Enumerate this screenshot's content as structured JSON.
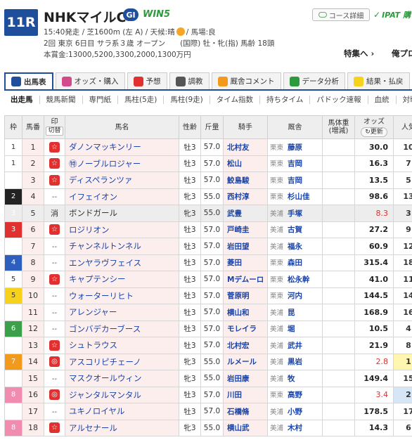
{
  "race": {
    "number": "11R",
    "name": "NHKマイルC",
    "grade": "GI",
    "win5": "WIN5",
    "line1_start": "15:40発走 / 芝1600m (左 A) / 天候:晴",
    "line1_end": "/ 馬場:良",
    "line2": "2回 東京 6日目 サラ系３歳 オープン　　(国際) 牡・牝(指) 馬齢 18頭",
    "line3": "本賞金:13000,5200,3300,2000,1300万円"
  },
  "buttons": {
    "course": "コース詳細",
    "ipat": "IPAT 購"
  },
  "features": {
    "special": "特集へ ›",
    "other": "俺プロ"
  },
  "tabs": [
    {
      "label": "出馬表",
      "color": "#1f4f9b"
    },
    {
      "label": "オッズ・購入",
      "color": "#d24a8a"
    },
    {
      "label": "予想",
      "color": "#e03030"
    },
    {
      "label": "調教",
      "color": "#555555"
    },
    {
      "label": "厩舎コメント",
      "color": "#f39a1c"
    },
    {
      "label": "データ分析",
      "color": "#2e9a3e"
    },
    {
      "label": "結果・払戻",
      "color": "#f6d21a"
    }
  ],
  "subtabs": [
    "出走馬",
    "競馬新聞",
    "専門紙",
    "馬柱(5走)",
    "馬柱(9走)",
    "タイム指数",
    "持ちタイム",
    "パドック速報",
    "血統",
    "対戦表"
  ],
  "columns": {
    "waku": "枠",
    "umaban": "馬番",
    "mark_top": "印",
    "mark_sub": "切替",
    "horse": "馬名",
    "sex_age": "性齢",
    "weight": "斤量",
    "jockey": "騎手",
    "trainer": "厩舎",
    "body_weight_top": "馬体重",
    "body_weight_sub": "(増減)",
    "odds": "オッズ",
    "odds_update": "更新",
    "popularity": "人気"
  },
  "rows": [
    {
      "waku": "1",
      "ban": "1",
      "mark": "☆",
      "horse": "ダノンマッキンリー",
      "sex": "牡3",
      "wt": "57.0",
      "jockey": "北村友",
      "region": "栗東",
      "trainer": "藤原",
      "odds": "30.0",
      "pop": "10"
    },
    {
      "waku": "1",
      "ban": "2",
      "mark": "☆",
      "horse": "㊕ノーブルロジャー",
      "sex": "牡3",
      "wt": "57.0",
      "jockey": "松山",
      "region": "栗東",
      "trainer": "吉岡",
      "odds": "16.3",
      "pop": "7"
    },
    {
      "waku": "2",
      "ban": "3",
      "mark": "☆",
      "horse": "ディスペランツァ",
      "sex": "牡3",
      "wt": "57.0",
      "jockey": "鮫島駿",
      "region": "栗東",
      "trainer": "吉岡",
      "odds": "13.5",
      "pop": "5"
    },
    {
      "waku": "2",
      "ban": "4",
      "mark": "--",
      "horse": "イフェイオン",
      "sex": "牝3",
      "wt": "55.0",
      "jockey": "西村淳",
      "region": "栗東",
      "trainer": "杉山佳",
      "odds": "98.6",
      "pop": "13"
    },
    {
      "waku": "3",
      "ban": "5",
      "mark": "消",
      "horse": "ボンドガール",
      "sex": "牝3",
      "wt": "55.0",
      "jockey": "武豊",
      "region": "美浦",
      "trainer": "手塚",
      "odds": "8.3",
      "pop": "3"
    },
    {
      "waku": "3",
      "ban": "6",
      "mark": "☆",
      "horse": "ロジリオン",
      "sex": "牡3",
      "wt": "57.0",
      "jockey": "戸崎圭",
      "region": "美浦",
      "trainer": "古賀",
      "odds": "27.2",
      "pop": "9"
    },
    {
      "waku": "4",
      "ban": "7",
      "mark": "--",
      "horse": "チャンネルトンネル",
      "sex": "牡3",
      "wt": "57.0",
      "jockey": "岩田望",
      "region": "美浦",
      "trainer": "福永",
      "odds": "60.9",
      "pop": "12"
    },
    {
      "waku": "4",
      "ban": "8",
      "mark": "--",
      "horse": "エンヤラヴフェイス",
      "sex": "牡3",
      "wt": "57.0",
      "jockey": "菱田",
      "region": "栗東",
      "trainer": "森田",
      "odds": "315.4",
      "pop": "18"
    },
    {
      "waku": "5",
      "ban": "9",
      "mark": "☆",
      "horse": "キャプテンシー",
      "sex": "牡3",
      "wt": "57.0",
      "jockey": "Mデムーロ",
      "region": "栗東",
      "trainer": "松永幹",
      "odds": "41.0",
      "pop": "11"
    },
    {
      "waku": "5",
      "ban": "10",
      "mark": "--",
      "horse": "ウォーターリヒト",
      "sex": "牡3",
      "wt": "57.0",
      "jockey": "菅原明",
      "region": "栗東",
      "trainer": "河内",
      "odds": "144.5",
      "pop": "14"
    },
    {
      "waku": "6",
      "ban": "11",
      "mark": "--",
      "horse": "アレンジャー",
      "sex": "牡3",
      "wt": "57.0",
      "jockey": "横山和",
      "region": "美浦",
      "trainer": "昆",
      "odds": "168.9",
      "pop": "16"
    },
    {
      "waku": "6",
      "ban": "12",
      "mark": "--",
      "horse": "ゴンバデカーブース",
      "sex": "牡3",
      "wt": "57.0",
      "jockey": "モレイラ",
      "region": "美浦",
      "trainer": "堀",
      "odds": "10.5",
      "pop": "4"
    },
    {
      "waku": "7",
      "ban": "13",
      "mark": "☆",
      "horse": "シュトラウス",
      "sex": "牡3",
      "wt": "57.0",
      "jockey": "北村宏",
      "region": "美浦",
      "trainer": "武井",
      "odds": "21.9",
      "pop": "8"
    },
    {
      "waku": "7",
      "ban": "14",
      "mark": "◎",
      "horse": "アスコリピチェーノ",
      "sex": "牝3",
      "wt": "55.0",
      "jockey": "ルメール",
      "region": "美浦",
      "trainer": "黒岩",
      "odds": "2.8",
      "pop": "1"
    },
    {
      "waku": "7",
      "ban": "15",
      "mark": "--",
      "horse": "マスクオールウィン",
      "sex": "牝3",
      "wt": "55.0",
      "jockey": "岩田康",
      "region": "美浦",
      "trainer": "牧",
      "odds": "149.4",
      "pop": "15"
    },
    {
      "waku": "8",
      "ban": "16",
      "mark": "◎",
      "horse": "ジャンタルマンタル",
      "sex": "牡3",
      "wt": "57.0",
      "jockey": "川田",
      "region": "栗東",
      "trainer": "高野",
      "odds": "3.4",
      "pop": "2"
    },
    {
      "waku": "8",
      "ban": "17",
      "mark": "--",
      "horse": "ユキノロイヤル",
      "sex": "牡3",
      "wt": "57.0",
      "jockey": "石橋脩",
      "region": "美浦",
      "trainer": "小野",
      "odds": "178.5",
      "pop": "17"
    },
    {
      "waku": "8",
      "ban": "18",
      "mark": "☆",
      "horse": "アルセナール",
      "sex": "牝3",
      "wt": "55.0",
      "jockey": "横山武",
      "region": "美浦",
      "trainer": "木村",
      "odds": "14.3",
      "pop": "6"
    }
  ]
}
